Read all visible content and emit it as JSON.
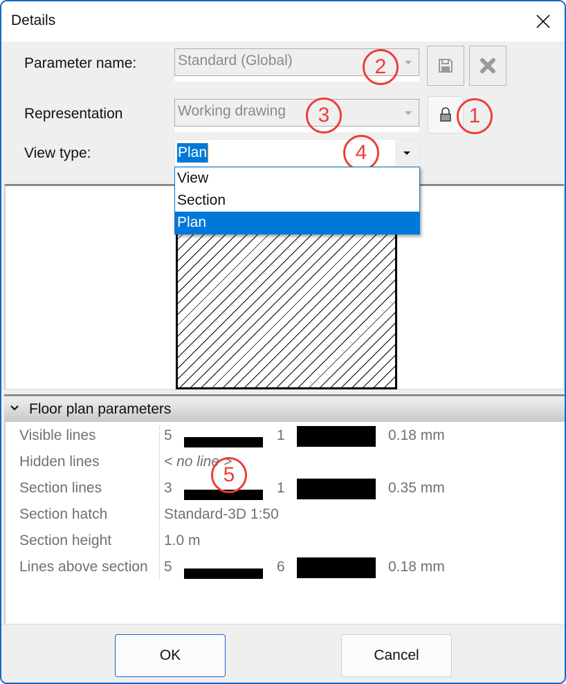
{
  "window": {
    "title": "Details",
    "close_icon": "close-icon"
  },
  "form": {
    "parameter_name": {
      "label": "Parameter name:",
      "value": "Standard (Global)"
    },
    "representation": {
      "label": "Representation",
      "value": "Working drawing"
    },
    "view_type": {
      "label": "View type:",
      "value": "Plan",
      "options": [
        "View",
        "Section",
        "Plan"
      ],
      "selected_index": 2
    },
    "buttons": {
      "save_icon": "floppy-disk-icon",
      "delete_icon": "x-icon",
      "lock_icon": "padlock-icon"
    }
  },
  "annotations": [
    "1",
    "2",
    "3",
    "4",
    "5"
  ],
  "preview": {
    "hatch": "diagonal-hatch"
  },
  "group": {
    "title": "Floor plan parameters",
    "expanded": true,
    "rows": [
      {
        "name": "Visible lines",
        "pen": "5",
        "color": "1",
        "thickness": "0.18 mm"
      },
      {
        "name": "Hidden lines",
        "value": "< no line >"
      },
      {
        "name": "Section lines",
        "pen": "3",
        "color": "1",
        "thickness": "0.35 mm"
      },
      {
        "name": "Section hatch",
        "value": "Standard-3D 1:50"
      },
      {
        "name": "Section height",
        "value": "1.0 m"
      },
      {
        "name": "Lines above section",
        "pen": "5",
        "color": "6",
        "thickness": "0.18 mm"
      }
    ]
  },
  "footer": {
    "ok_label": "OK",
    "cancel_label": "Cancel"
  },
  "colors": {
    "accent": "#0078d7",
    "window_border": "#1366c9",
    "annotation": "#ef3b3b"
  }
}
